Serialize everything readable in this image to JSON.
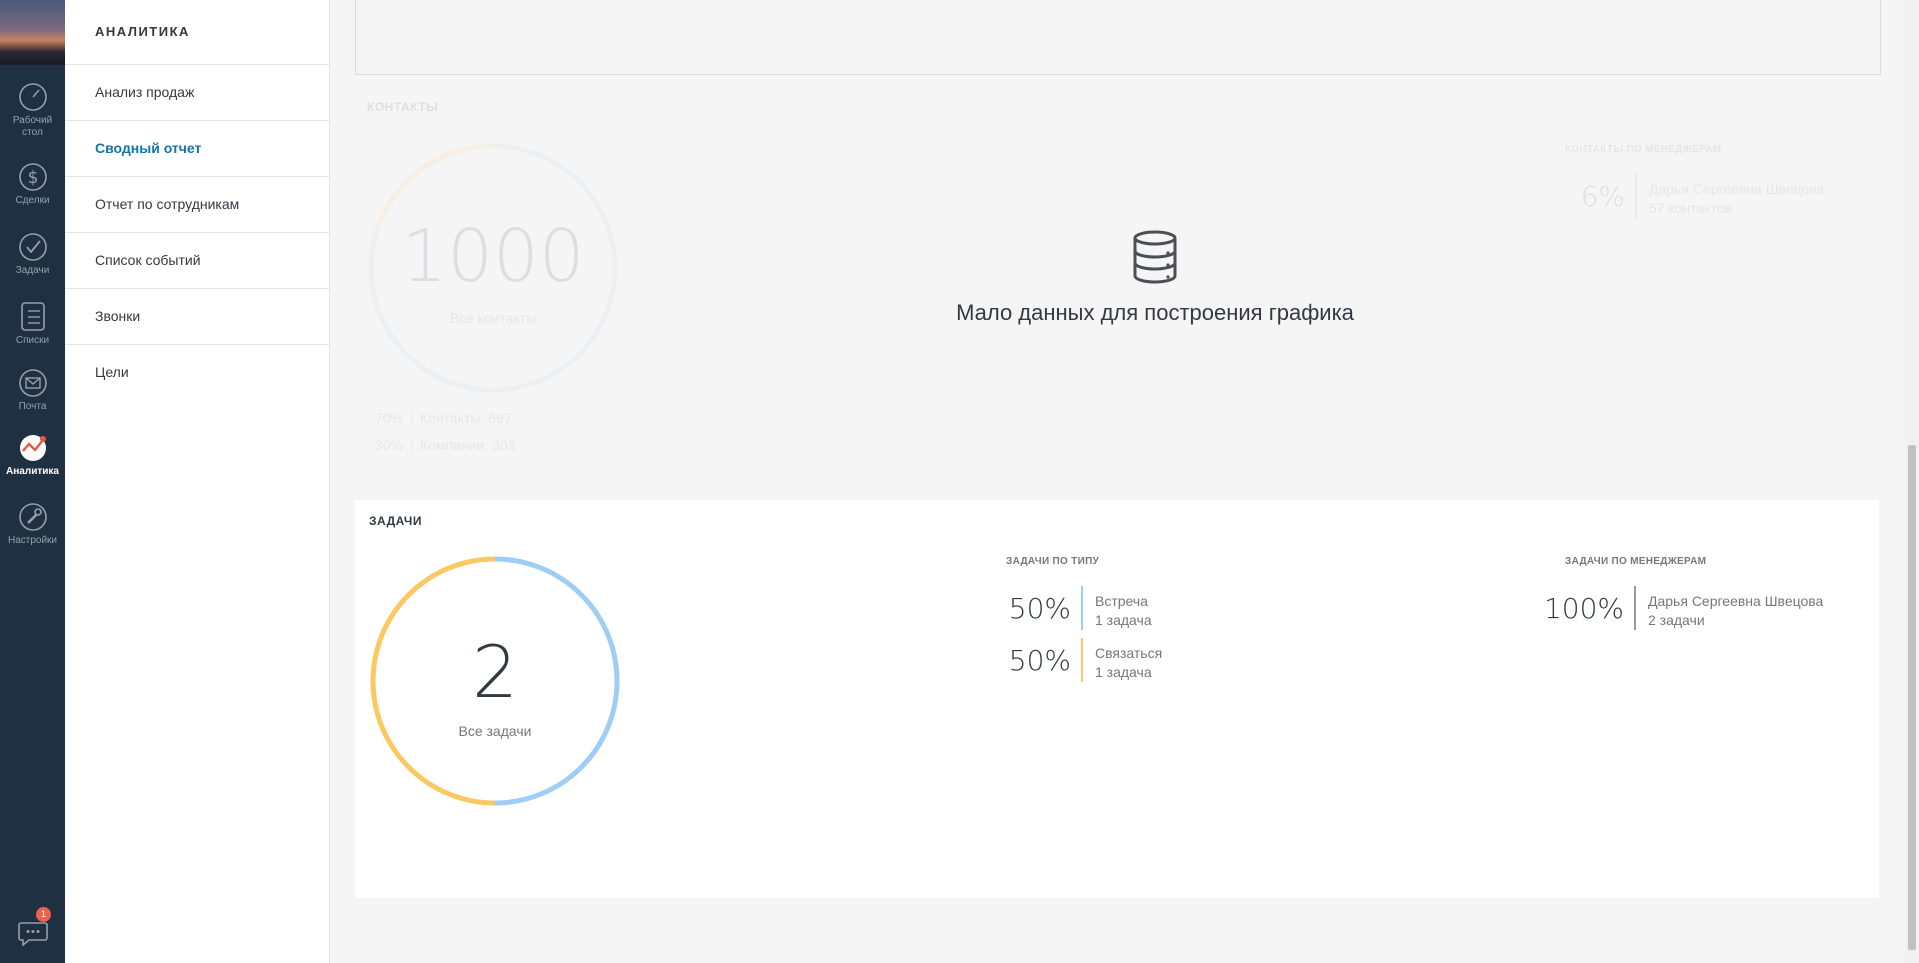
{
  "rail": {
    "items": [
      {
        "label1": "Рабочий",
        "label2": "стол"
      },
      {
        "label1": "Сделки"
      },
      {
        "label1": "Задачи"
      },
      {
        "label1": "Списки"
      },
      {
        "label1": "Почта"
      },
      {
        "label1": "Аналитика"
      },
      {
        "label1": "Настройки"
      }
    ],
    "chat_badge": "1"
  },
  "submenu": {
    "title": "АНАЛИТИКА",
    "items": [
      "Анализ продаж",
      "Сводный отчет",
      "Отчет по сотрудникам",
      "Список событий",
      "Звонки",
      "Цели"
    ],
    "active": "Сводный отчет"
  },
  "contacts": {
    "title": "КОНТАКТЫ",
    "total": "1000",
    "total_caption": "Все контакты",
    "legend": [
      {
        "pct": "70%",
        "label": "Контакты:",
        "value": "697"
      },
      {
        "pct": "30%",
        "label": "Компании:",
        "value": "303"
      }
    ],
    "by_managers_title": "КОНТАКТЫ ПО МЕНЕДЖЕРАМ",
    "by_managers": [
      {
        "pct": "6%",
        "name": "Дарья Сергеевна Швецова",
        "count": "57 контактов"
      }
    ],
    "no_data_text": "Мало данных для построения графика"
  },
  "tasks": {
    "title": "ЗАДАЧИ",
    "total": "2",
    "total_caption": "Все задачи",
    "by_type_title": "ЗАДАЧИ ПО ТИПУ",
    "by_type": [
      {
        "pct": "50%",
        "name": "Встреча",
        "count": "1 задача",
        "color": "#9ecdf5"
      },
      {
        "pct": "50%",
        "name": "Связаться",
        "count": "1 задача",
        "color": "#fcc862"
      }
    ],
    "by_managers_title": "ЗАДАЧИ ПО МЕНЕДЖЕРАМ",
    "by_managers": [
      {
        "pct": "100%",
        "name": "Дарья Сергеевна Швецова",
        "count": "2 задачи"
      }
    ]
  },
  "colors": {
    "blue": "#9ecdf5",
    "yellow": "#fcc862",
    "accent": "#1375ab",
    "rail": "#1f3042"
  }
}
